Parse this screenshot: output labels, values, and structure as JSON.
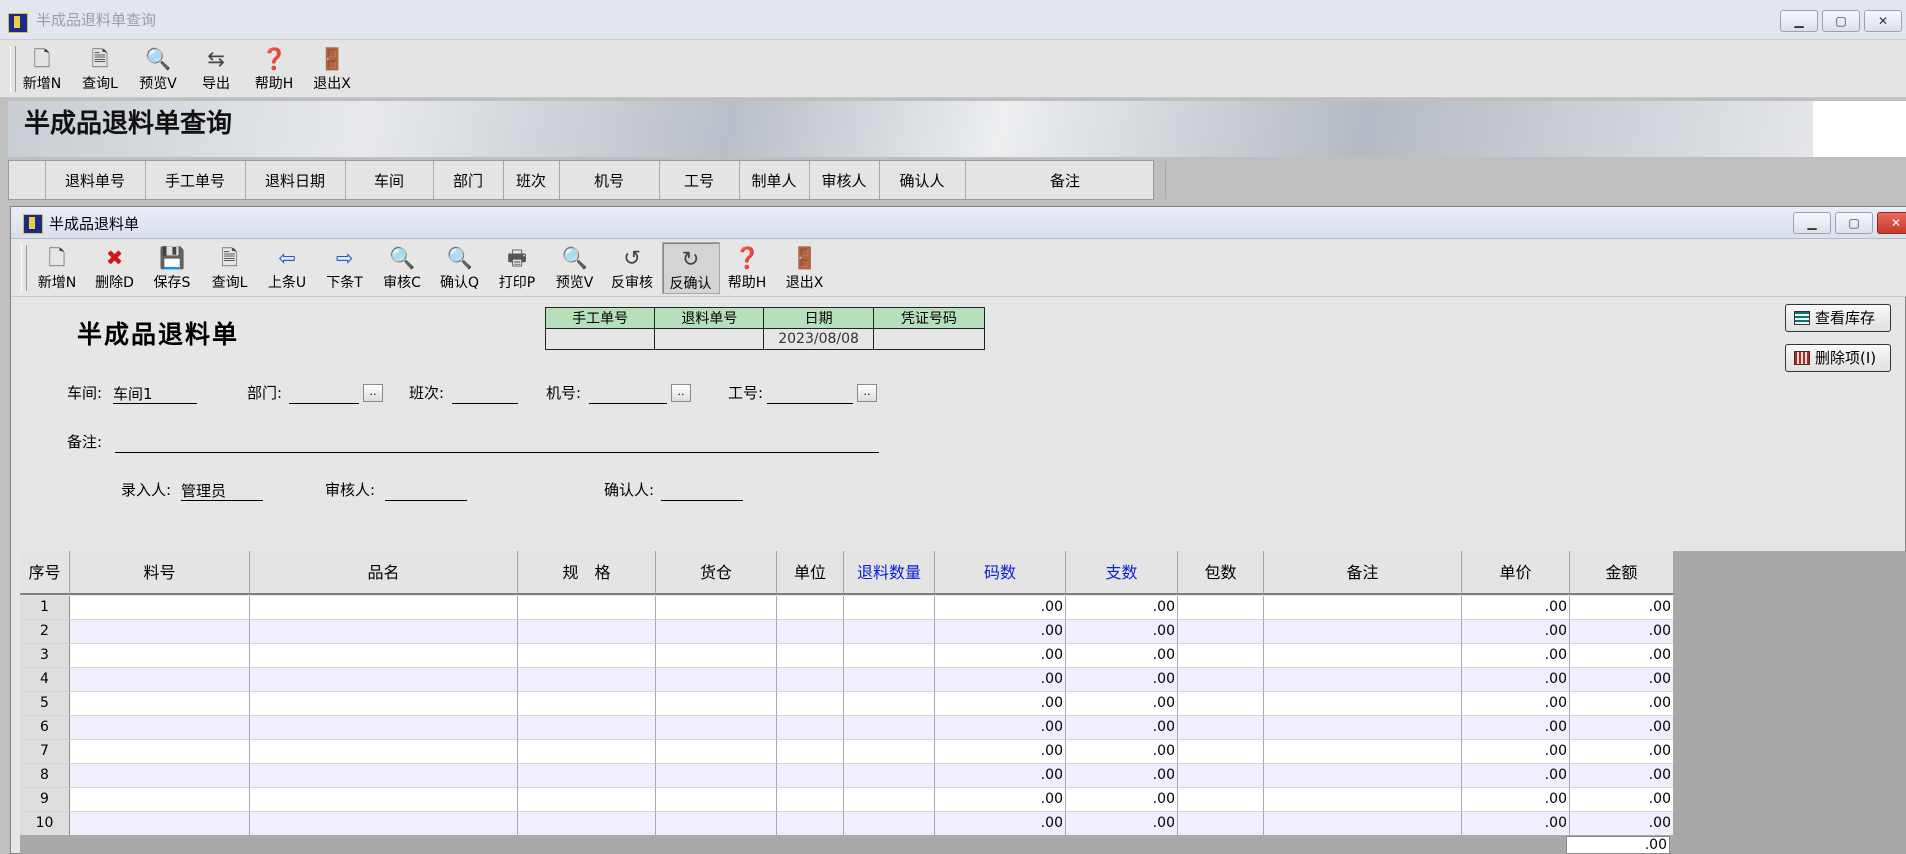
{
  "outer_window": {
    "title": "半成品退料单查询",
    "toolbar": [
      {
        "label": "新增N",
        "icon": "new-file-icon"
      },
      {
        "label": "查询L",
        "icon": "query-doc-icon"
      },
      {
        "label": "预览V",
        "icon": "magnifier-icon"
      },
      {
        "label": "导出",
        "icon": "export-icon"
      },
      {
        "label": "帮助H",
        "icon": "help-icon"
      },
      {
        "label": "退出X",
        "icon": "exit-door-icon"
      }
    ],
    "banner_title": "半成品退料单查询",
    "query_columns": [
      "退料单号",
      "手工单号",
      "退料日期",
      "车间",
      "部门",
      "班次",
      "机号",
      "工号",
      "制单人",
      "审核人",
      "确认人",
      "备注"
    ]
  },
  "inner_window": {
    "title": "半成品退料单",
    "toolbar": [
      {
        "label": "新增N",
        "icon": "new-file-icon"
      },
      {
        "label": "删除D",
        "icon": "delete-x-icon"
      },
      {
        "label": "保存S",
        "icon": "floppy-save-icon"
      },
      {
        "label": "查询L",
        "icon": "query-doc-icon"
      },
      {
        "label": "上条U",
        "icon": "arrow-left-icon"
      },
      {
        "label": "下条T",
        "icon": "arrow-right-icon"
      },
      {
        "label": "审核C",
        "icon": "magnifier-icon"
      },
      {
        "label": "确认Q",
        "icon": "magnifier-icon"
      },
      {
        "label": "打印P",
        "icon": "printer-icon"
      },
      {
        "label": "预览V",
        "icon": "magnifier-icon"
      },
      {
        "label": "反审核",
        "icon": "unaudit-icon"
      },
      {
        "label": "反确认",
        "icon": "unconfirm-icon"
      },
      {
        "label": "帮助H",
        "icon": "help-icon"
      },
      {
        "label": "退出X",
        "icon": "exit-door-icon"
      }
    ],
    "form_title": "半成品退料单",
    "doc_headers": [
      "手工单号",
      "退料单号",
      "日期",
      "凭证号码"
    ],
    "doc_values": [
      "",
      "",
      "2023/08/08",
      ""
    ],
    "fields": {
      "workshop_label": "车间:",
      "workshop_value": "车间1",
      "dept_label": "部门:",
      "dept_value": "",
      "shift_label": "班次:",
      "shift_value": "",
      "machine_label": "机号:",
      "machine_value": "",
      "worker_label": "工号:",
      "worker_value": "",
      "remark_label": "备注:",
      "remark_value": "",
      "entry_label": "录入人:",
      "entry_value": "管理员",
      "auditor_label": "审核人:",
      "auditor_value": "",
      "confirmer_label": "确认人:",
      "confirmer_value": ""
    },
    "side_buttons": {
      "view_stock": "查看库存",
      "delete_item": "删除项(I)"
    },
    "ellipsis": "..",
    "grid": {
      "columns": [
        {
          "label": "序号",
          "blue": false
        },
        {
          "label": "料号",
          "blue": false
        },
        {
          "label": "品名",
          "blue": false
        },
        {
          "label": "规　格",
          "blue": false
        },
        {
          "label": "货仓",
          "blue": false
        },
        {
          "label": "单位",
          "blue": false
        },
        {
          "label": "退料数量",
          "blue": true
        },
        {
          "label": "码数",
          "blue": true
        },
        {
          "label": "支数",
          "blue": true
        },
        {
          "label": "包数",
          "blue": false
        },
        {
          "label": "备注",
          "blue": false
        },
        {
          "label": "单价",
          "blue": false
        },
        {
          "label": "金额",
          "blue": false
        }
      ],
      "rows": [
        {
          "no": "1",
          "code_count": ".00",
          "sticks": ".00",
          "price": ".00",
          "amount": ".00"
        },
        {
          "no": "2",
          "code_count": ".00",
          "sticks": ".00",
          "price": ".00",
          "amount": ".00"
        },
        {
          "no": "3",
          "code_count": ".00",
          "sticks": ".00",
          "price": ".00",
          "amount": ".00"
        },
        {
          "no": "4",
          "code_count": ".00",
          "sticks": ".00",
          "price": ".00",
          "amount": ".00"
        },
        {
          "no": "5",
          "code_count": ".00",
          "sticks": ".00",
          "price": ".00",
          "amount": ".00"
        },
        {
          "no": "6",
          "code_count": ".00",
          "sticks": ".00",
          "price": ".00",
          "amount": ".00"
        },
        {
          "no": "7",
          "code_count": ".00",
          "sticks": ".00",
          "price": ".00",
          "amount": ".00"
        },
        {
          "no": "8",
          "code_count": ".00",
          "sticks": ".00",
          "price": ".00",
          "amount": ".00"
        },
        {
          "no": "9",
          "code_count": ".00",
          "sticks": ".00",
          "price": ".00",
          "amount": ".00"
        },
        {
          "no": "10",
          "code_count": ".00",
          "sticks": ".00",
          "price": ".00",
          "amount": ".00"
        }
      ],
      "total_amount": ".00"
    }
  },
  "colors": {
    "accent_blue": "#0a22d8",
    "doc_header_green": "#b7dfb9",
    "row_alt": "#eeeefc"
  }
}
